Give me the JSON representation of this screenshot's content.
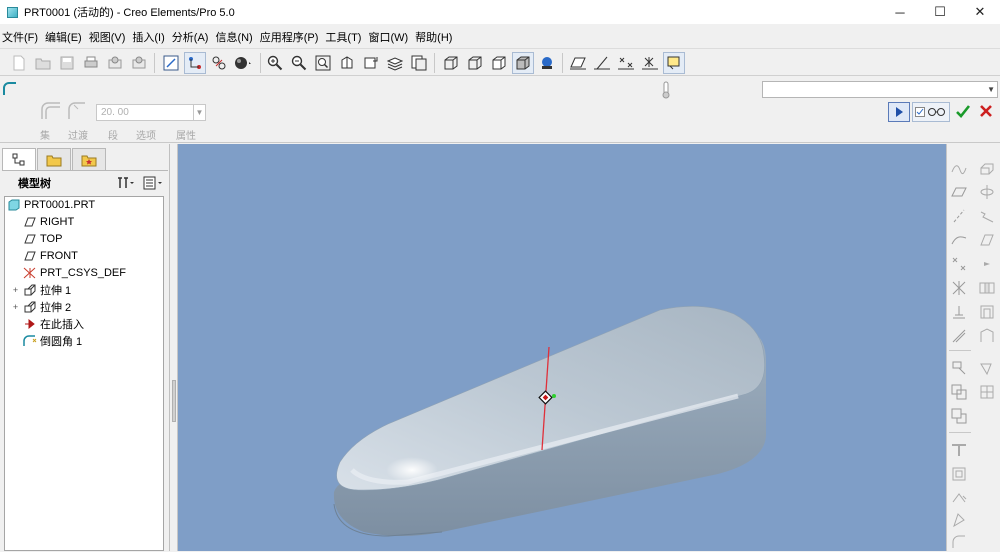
{
  "window": {
    "title": "PRT0001 (活动的) - Creo Elements/Pro 5.0",
    "controls": [
      "─",
      "☐",
      "✕"
    ]
  },
  "menu": [
    "文件(F)",
    "编辑(E)",
    "视图(V)",
    "插入(I)",
    "分析(A)",
    "信息(N)",
    "应用程序(P)",
    "工具(T)",
    "窗口(W)",
    "帮助(H)"
  ],
  "dashboard": {
    "depth_value": "20. 00",
    "tab_labels": [
      "集",
      "过渡",
      "段",
      "选项",
      "属性"
    ],
    "filter_value": ""
  },
  "model_tree": {
    "title": "模型树",
    "items": [
      {
        "label": "PRT0001.PRT",
        "icon": "part-icon"
      },
      {
        "label": "RIGHT",
        "icon": "datum-plane-icon"
      },
      {
        "label": "TOP",
        "icon": "datum-plane-icon"
      },
      {
        "label": "FRONT",
        "icon": "datum-plane-icon"
      },
      {
        "label": "PRT_CSYS_DEF",
        "icon": "csys-icon"
      },
      {
        "label": "拉伸 1",
        "icon": "extrude-icon"
      },
      {
        "label": "拉伸 2",
        "icon": "extrude-icon"
      },
      {
        "label": "在此插入",
        "icon": "insert-here-icon"
      },
      {
        "label": "倒圆角 1",
        "icon": "round-icon"
      }
    ]
  },
  "colors": {
    "viewport_bg": "#7f9ec7",
    "model_surface": "#c9d3dc",
    "selection_edge": "#e0303a",
    "accept": "#1a9a2a",
    "cancel": "#cc1f1f"
  }
}
